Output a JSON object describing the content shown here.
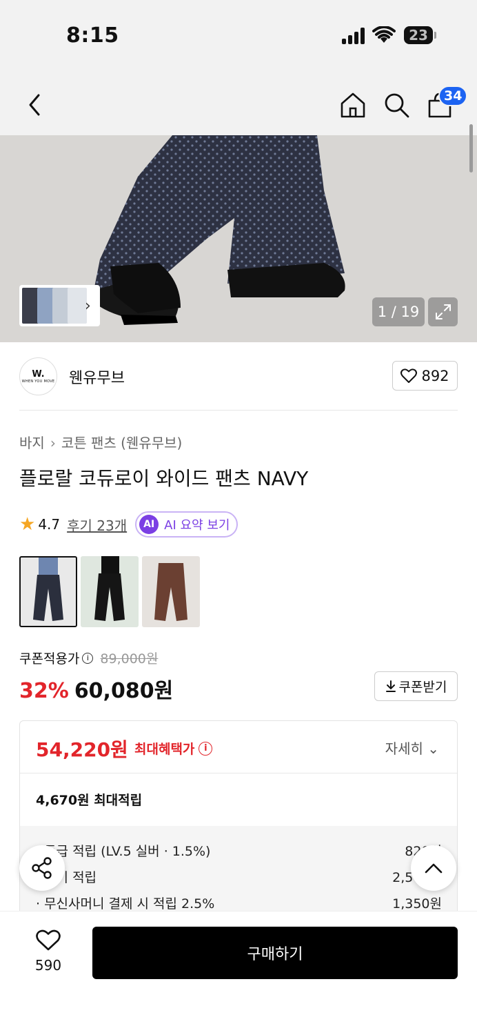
{
  "status_bar": {
    "time": "8:15",
    "battery": "23"
  },
  "nav": {
    "cart_count": "34"
  },
  "hero": {
    "counter": "1 / 19"
  },
  "brand": {
    "logo_text": "W.",
    "logo_sub": "WHEN YOU MOVE",
    "name": "웬유무브",
    "likes": "892"
  },
  "breadcrumb": {
    "category": "바지",
    "subcategory": "코튼 팬츠 (웬유무브)"
  },
  "product": {
    "title": "플로랄 코듀로이 와이드 팬츠 NAVY",
    "rating": "4.7",
    "reviews": "후기 23개",
    "ai_badge": "AI",
    "ai_summary": "AI 요약 보기"
  },
  "price": {
    "coupon_label": "쿠폰적용가",
    "original": "89,000원",
    "discount": "32%",
    "final": "60,080원",
    "coupon_button": "쿠폰받기"
  },
  "benefits": {
    "max_price": "54,220원",
    "max_label": "최대혜택가",
    "detail": "자세히",
    "max_points": "4,670원 최대적립",
    "items": [
      {
        "label": "· 등급 적립 (LV.5 실버 · 1.5%)",
        "value": "820원"
      },
      {
        "label": "· 후기 적립",
        "value": "2,500원"
      },
      {
        "label": "· 무신사머니 결제 시 적립 2.5%",
        "value": "1,350원"
      }
    ]
  },
  "bottom": {
    "wish_count": "590",
    "buy_label": "구매하기"
  },
  "colors": {
    "accent_red": "#e2252b",
    "badge_blue": "#1c63f2",
    "ai_purple": "#7b3fe4"
  }
}
